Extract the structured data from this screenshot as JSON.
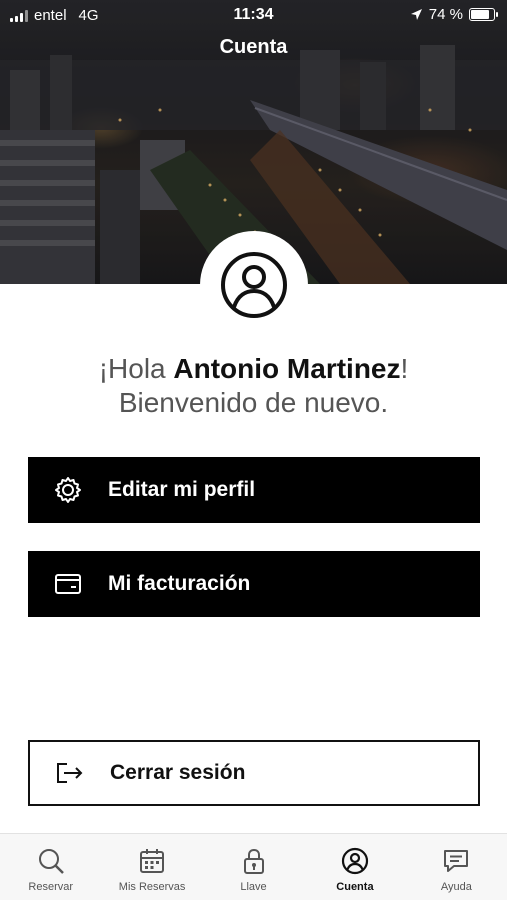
{
  "status_bar": {
    "carrier": "entel",
    "network": "4G",
    "time": "11:34",
    "battery": "74 %",
    "battery_level": 0.74
  },
  "header": {
    "title": "Cuenta"
  },
  "greeting": {
    "prefix": "¡Hola ",
    "name": "Antonio Martinez",
    "suffix": "!",
    "subtitle": "Bienvenido de nuevo."
  },
  "actions": {
    "edit_profile": {
      "label": "Editar mi perfil",
      "icon": "gear-icon"
    },
    "billing": {
      "label": "Mi facturación",
      "icon": "card-icon"
    },
    "logout": {
      "label": "Cerrar sesión",
      "icon": "logout-icon"
    }
  },
  "tabs": [
    {
      "label": "Reservar",
      "icon": "search-icon",
      "active": false
    },
    {
      "label": "Mis Reservas",
      "icon": "calendar-icon",
      "active": false
    },
    {
      "label": "Llave",
      "icon": "key-lock-icon",
      "active": false
    },
    {
      "label": "Cuenta",
      "icon": "account-icon",
      "active": true
    },
    {
      "label": "Ayuda",
      "icon": "chat-icon",
      "active": false
    }
  ],
  "colors": {
    "primary": "#000000",
    "background": "#ffffff",
    "tab_bar": "#f7f7f7"
  }
}
